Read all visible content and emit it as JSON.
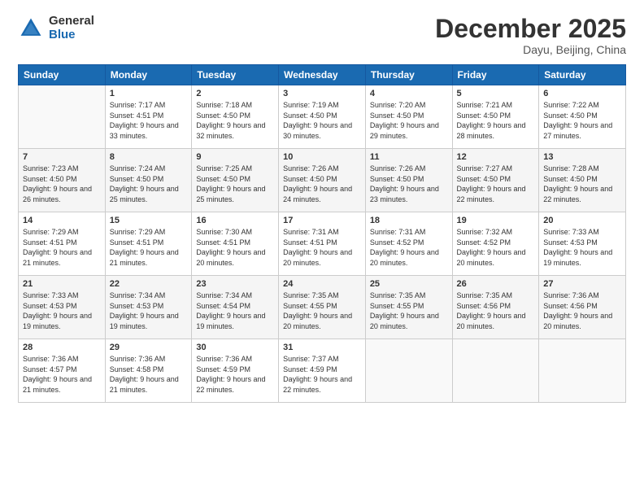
{
  "logo": {
    "general": "General",
    "blue": "Blue"
  },
  "title": "December 2025",
  "location": "Dayu, Beijing, China",
  "days_header": [
    "Sunday",
    "Monday",
    "Tuesday",
    "Wednesday",
    "Thursday",
    "Friday",
    "Saturday"
  ],
  "weeks": [
    [
      {
        "day": "",
        "sunrise": "",
        "sunset": "",
        "daylight": ""
      },
      {
        "day": "1",
        "sunrise": "Sunrise: 7:17 AM",
        "sunset": "Sunset: 4:51 PM",
        "daylight": "Daylight: 9 hours and 33 minutes."
      },
      {
        "day": "2",
        "sunrise": "Sunrise: 7:18 AM",
        "sunset": "Sunset: 4:50 PM",
        "daylight": "Daylight: 9 hours and 32 minutes."
      },
      {
        "day": "3",
        "sunrise": "Sunrise: 7:19 AM",
        "sunset": "Sunset: 4:50 PM",
        "daylight": "Daylight: 9 hours and 30 minutes."
      },
      {
        "day": "4",
        "sunrise": "Sunrise: 7:20 AM",
        "sunset": "Sunset: 4:50 PM",
        "daylight": "Daylight: 9 hours and 29 minutes."
      },
      {
        "day": "5",
        "sunrise": "Sunrise: 7:21 AM",
        "sunset": "Sunset: 4:50 PM",
        "daylight": "Daylight: 9 hours and 28 minutes."
      },
      {
        "day": "6",
        "sunrise": "Sunrise: 7:22 AM",
        "sunset": "Sunset: 4:50 PM",
        "daylight": "Daylight: 9 hours and 27 minutes."
      }
    ],
    [
      {
        "day": "7",
        "sunrise": "Sunrise: 7:23 AM",
        "sunset": "Sunset: 4:50 PM",
        "daylight": "Daylight: 9 hours and 26 minutes."
      },
      {
        "day": "8",
        "sunrise": "Sunrise: 7:24 AM",
        "sunset": "Sunset: 4:50 PM",
        "daylight": "Daylight: 9 hours and 25 minutes."
      },
      {
        "day": "9",
        "sunrise": "Sunrise: 7:25 AM",
        "sunset": "Sunset: 4:50 PM",
        "daylight": "Daylight: 9 hours and 25 minutes."
      },
      {
        "day": "10",
        "sunrise": "Sunrise: 7:26 AM",
        "sunset": "Sunset: 4:50 PM",
        "daylight": "Daylight: 9 hours and 24 minutes."
      },
      {
        "day": "11",
        "sunrise": "Sunrise: 7:26 AM",
        "sunset": "Sunset: 4:50 PM",
        "daylight": "Daylight: 9 hours and 23 minutes."
      },
      {
        "day": "12",
        "sunrise": "Sunrise: 7:27 AM",
        "sunset": "Sunset: 4:50 PM",
        "daylight": "Daylight: 9 hours and 22 minutes."
      },
      {
        "day": "13",
        "sunrise": "Sunrise: 7:28 AM",
        "sunset": "Sunset: 4:50 PM",
        "daylight": "Daylight: 9 hours and 22 minutes."
      }
    ],
    [
      {
        "day": "14",
        "sunrise": "Sunrise: 7:29 AM",
        "sunset": "Sunset: 4:51 PM",
        "daylight": "Daylight: 9 hours and 21 minutes."
      },
      {
        "day": "15",
        "sunrise": "Sunrise: 7:29 AM",
        "sunset": "Sunset: 4:51 PM",
        "daylight": "Daylight: 9 hours and 21 minutes."
      },
      {
        "day": "16",
        "sunrise": "Sunrise: 7:30 AM",
        "sunset": "Sunset: 4:51 PM",
        "daylight": "Daylight: 9 hours and 20 minutes."
      },
      {
        "day": "17",
        "sunrise": "Sunrise: 7:31 AM",
        "sunset": "Sunset: 4:51 PM",
        "daylight": "Daylight: 9 hours and 20 minutes."
      },
      {
        "day": "18",
        "sunrise": "Sunrise: 7:31 AM",
        "sunset": "Sunset: 4:52 PM",
        "daylight": "Daylight: 9 hours and 20 minutes."
      },
      {
        "day": "19",
        "sunrise": "Sunrise: 7:32 AM",
        "sunset": "Sunset: 4:52 PM",
        "daylight": "Daylight: 9 hours and 20 minutes."
      },
      {
        "day": "20",
        "sunrise": "Sunrise: 7:33 AM",
        "sunset": "Sunset: 4:53 PM",
        "daylight": "Daylight: 9 hours and 19 minutes."
      }
    ],
    [
      {
        "day": "21",
        "sunrise": "Sunrise: 7:33 AM",
        "sunset": "Sunset: 4:53 PM",
        "daylight": "Daylight: 9 hours and 19 minutes."
      },
      {
        "day": "22",
        "sunrise": "Sunrise: 7:34 AM",
        "sunset": "Sunset: 4:53 PM",
        "daylight": "Daylight: 9 hours and 19 minutes."
      },
      {
        "day": "23",
        "sunrise": "Sunrise: 7:34 AM",
        "sunset": "Sunset: 4:54 PM",
        "daylight": "Daylight: 9 hours and 19 minutes."
      },
      {
        "day": "24",
        "sunrise": "Sunrise: 7:35 AM",
        "sunset": "Sunset: 4:55 PM",
        "daylight": "Daylight: 9 hours and 20 minutes."
      },
      {
        "day": "25",
        "sunrise": "Sunrise: 7:35 AM",
        "sunset": "Sunset: 4:55 PM",
        "daylight": "Daylight: 9 hours and 20 minutes."
      },
      {
        "day": "26",
        "sunrise": "Sunrise: 7:35 AM",
        "sunset": "Sunset: 4:56 PM",
        "daylight": "Daylight: 9 hours and 20 minutes."
      },
      {
        "day": "27",
        "sunrise": "Sunrise: 7:36 AM",
        "sunset": "Sunset: 4:56 PM",
        "daylight": "Daylight: 9 hours and 20 minutes."
      }
    ],
    [
      {
        "day": "28",
        "sunrise": "Sunrise: 7:36 AM",
        "sunset": "Sunset: 4:57 PM",
        "daylight": "Daylight: 9 hours and 21 minutes."
      },
      {
        "day": "29",
        "sunrise": "Sunrise: 7:36 AM",
        "sunset": "Sunset: 4:58 PM",
        "daylight": "Daylight: 9 hours and 21 minutes."
      },
      {
        "day": "30",
        "sunrise": "Sunrise: 7:36 AM",
        "sunset": "Sunset: 4:59 PM",
        "daylight": "Daylight: 9 hours and 22 minutes."
      },
      {
        "day": "31",
        "sunrise": "Sunrise: 7:37 AM",
        "sunset": "Sunset: 4:59 PM",
        "daylight": "Daylight: 9 hours and 22 minutes."
      },
      {
        "day": "",
        "sunrise": "",
        "sunset": "",
        "daylight": ""
      },
      {
        "day": "",
        "sunrise": "",
        "sunset": "",
        "daylight": ""
      },
      {
        "day": "",
        "sunrise": "",
        "sunset": "",
        "daylight": ""
      }
    ]
  ]
}
